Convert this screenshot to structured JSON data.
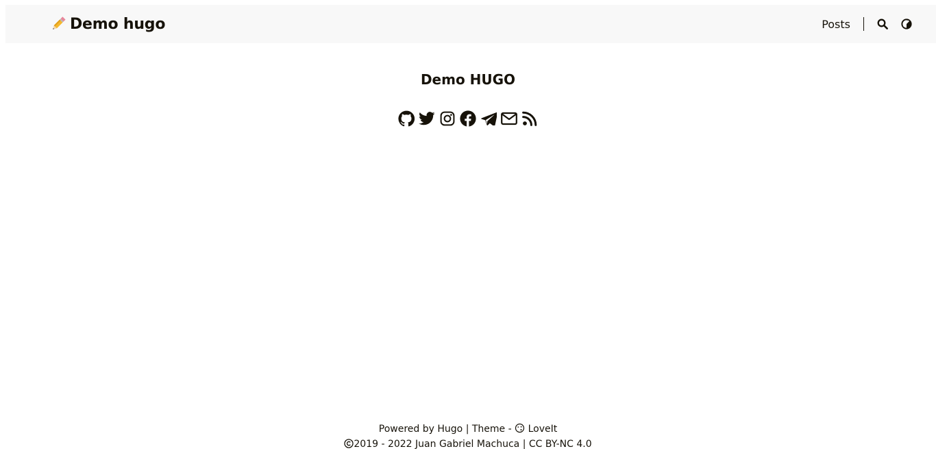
{
  "header": {
    "logo_emoji": "pencil-emoji",
    "logo_text": "Demo hugo",
    "nav": {
      "posts_label": "Posts",
      "search_icon": "search-icon",
      "theme_icon": "theme-switch-icon"
    }
  },
  "main": {
    "title": "Demo HUGO",
    "social": [
      {
        "icon": "github-icon"
      },
      {
        "icon": "twitter-icon"
      },
      {
        "icon": "instagram-icon"
      },
      {
        "icon": "facebook-icon"
      },
      {
        "icon": "telegram-icon"
      },
      {
        "icon": "email-icon"
      },
      {
        "icon": "rss-icon"
      }
    ]
  },
  "footer": {
    "powered_by": "Powered by",
    "hugo_link": "Hugo",
    "separator": "|",
    "theme_label": "Theme -",
    "theme_link": "LoveIt",
    "copyright_years": "2019 - 2022",
    "author": "Juan Gabriel Machuca",
    "license": "CC BY-NC 4.0"
  },
  "colors": {
    "text": "#161209",
    "header_bg": "#f8f8f8",
    "page_bg": "#ffffff"
  }
}
